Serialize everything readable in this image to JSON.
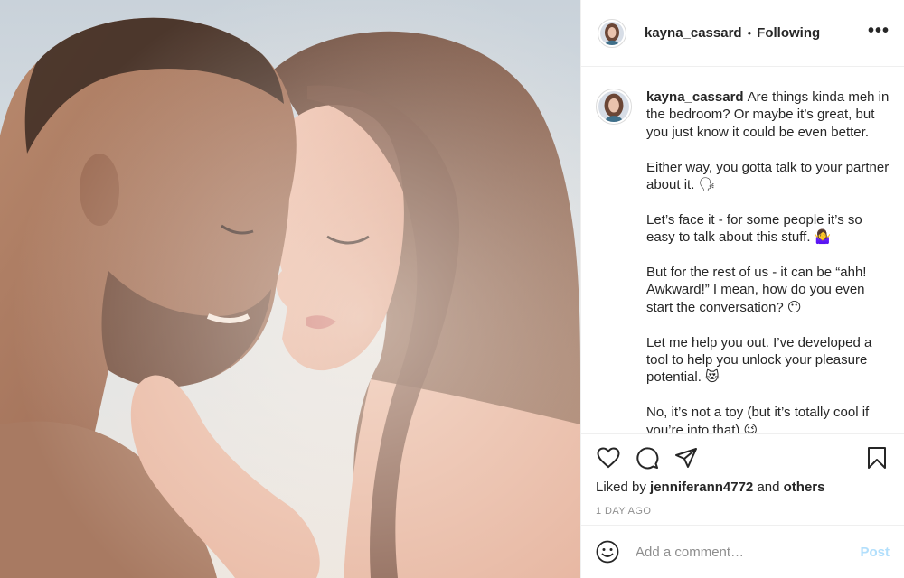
{
  "colors": {
    "text": "#262626",
    "muted": "#8e8e8e",
    "border": "#efefef",
    "post_button": "#b2dffc"
  },
  "post": {
    "image_alt": "Couple touching foreheads on a beach"
  },
  "header": {
    "username": "kayna_cassard",
    "separator": "•",
    "follow_status": "Following",
    "more_icon": "more-horizontal-icon",
    "more_label": "•••"
  },
  "caption": {
    "username": "kayna_cassard",
    "paragraphs": [
      "Are things kinda meh in the bedroom? Or maybe it’s great, but you just know it could be even better.",
      "Either way, you gotta talk to your partner about it. 🗣",
      "Let’s face it - for some people it’s so easy to talk about this stuff. 🤷‍♀️",
      "But for the rest of us - it can be “ahh! Awkward!” I mean, how do you even start the conversation? 😶",
      "Let me help you out. I’ve developed a tool to help you unlock your pleasure potential. 😻",
      "No, it’s not a toy (but it’s totally cool if you’re into that) 😉"
    ]
  },
  "actions": {
    "like_icon": "heart-icon",
    "comment_icon": "comment-icon",
    "share_icon": "share-icon",
    "save_icon": "bookmark-icon"
  },
  "likes": {
    "prefix": "Liked by",
    "user": "jenniferann4772",
    "joiner": "and",
    "others": "others"
  },
  "timestamp": "1 DAY AGO",
  "comment": {
    "emoji_icon": "smiley-icon",
    "placeholder": "Add a comment…",
    "post_label": "Post"
  }
}
